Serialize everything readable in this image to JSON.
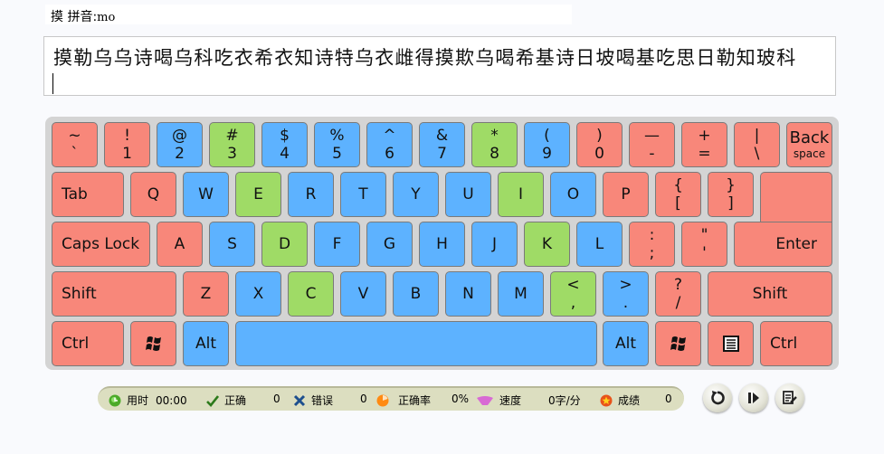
{
  "header": {
    "char": "摸",
    "pinyin_label": "拼音:",
    "pinyin_value": "mo"
  },
  "practice_text": {
    "content": "摸勒乌乌诗喝乌科吃衣希衣知诗特乌衣雌得摸欺乌喝希基诗日坡喝基吃思日勒知玻科",
    "input_value": ""
  },
  "colors": {
    "red": "#f8877a",
    "blue": "#5db2ff",
    "green": "#9fdb66",
    "keyboard_bg": "#d4d4d4"
  },
  "keyboard": {
    "row1": [
      {
        "top": "~",
        "bottom": "`"
      },
      {
        "top": "!",
        "bottom": "1"
      },
      {
        "top": "@",
        "bottom": "2"
      },
      {
        "top": "#",
        "bottom": "3"
      },
      {
        "top": "$",
        "bottom": "4"
      },
      {
        "top": "%",
        "bottom": "5"
      },
      {
        "top": "^",
        "bottom": "6"
      },
      {
        "top": "&",
        "bottom": "7"
      },
      {
        "top": "*",
        "bottom": "8"
      },
      {
        "top": "(",
        "bottom": "9"
      },
      {
        "top": ")",
        "bottom": "0"
      },
      {
        "top": "—",
        "bottom": "-"
      },
      {
        "top": "+",
        "bottom": "="
      },
      {
        "top": "|",
        "bottom": "\\"
      }
    ],
    "backspace": {
      "line1": "Back",
      "line2": "space"
    },
    "tab": "Tab",
    "row2": [
      "Q",
      "W",
      "E",
      "R",
      "T",
      "Y",
      "U",
      "I",
      "O",
      "P"
    ],
    "row2_sym": [
      {
        "top": "{",
        "bottom": "["
      },
      {
        "top": "}",
        "bottom": "]"
      }
    ],
    "enter": "Enter",
    "caps": "Caps Lock",
    "row3": [
      "A",
      "S",
      "D",
      "F",
      "G",
      "H",
      "J",
      "K",
      "L"
    ],
    "row3_sym": [
      {
        "top": ":",
        "bottom": ";"
      },
      {
        "top": "\"",
        "bottom": "'"
      }
    ],
    "shift_left": "Shift",
    "row4": [
      "Z",
      "X",
      "C",
      "V",
      "B",
      "N",
      "M"
    ],
    "row4_sym": [
      {
        "top": "<",
        "bottom": ","
      },
      {
        "top": ">",
        "bottom": "."
      },
      {
        "top": "?",
        "bottom": "/"
      }
    ],
    "shift_right": "Shift",
    "ctrl_left": "Ctrl",
    "alt_left": "Alt",
    "alt_right": "Alt",
    "ctrl_right": "Ctrl"
  },
  "stats": {
    "time_label": "用时",
    "time_value": "00:00",
    "correct_label": "正确",
    "correct_value": "0",
    "error_label": "错误",
    "error_value": "0",
    "accuracy_label": "正确率",
    "accuracy_value": "0%",
    "speed_label": "速度",
    "speed_value": "0字/分",
    "score_label": "成绩",
    "score_value": "0"
  },
  "controls": [
    "restart",
    "pause",
    "report"
  ]
}
